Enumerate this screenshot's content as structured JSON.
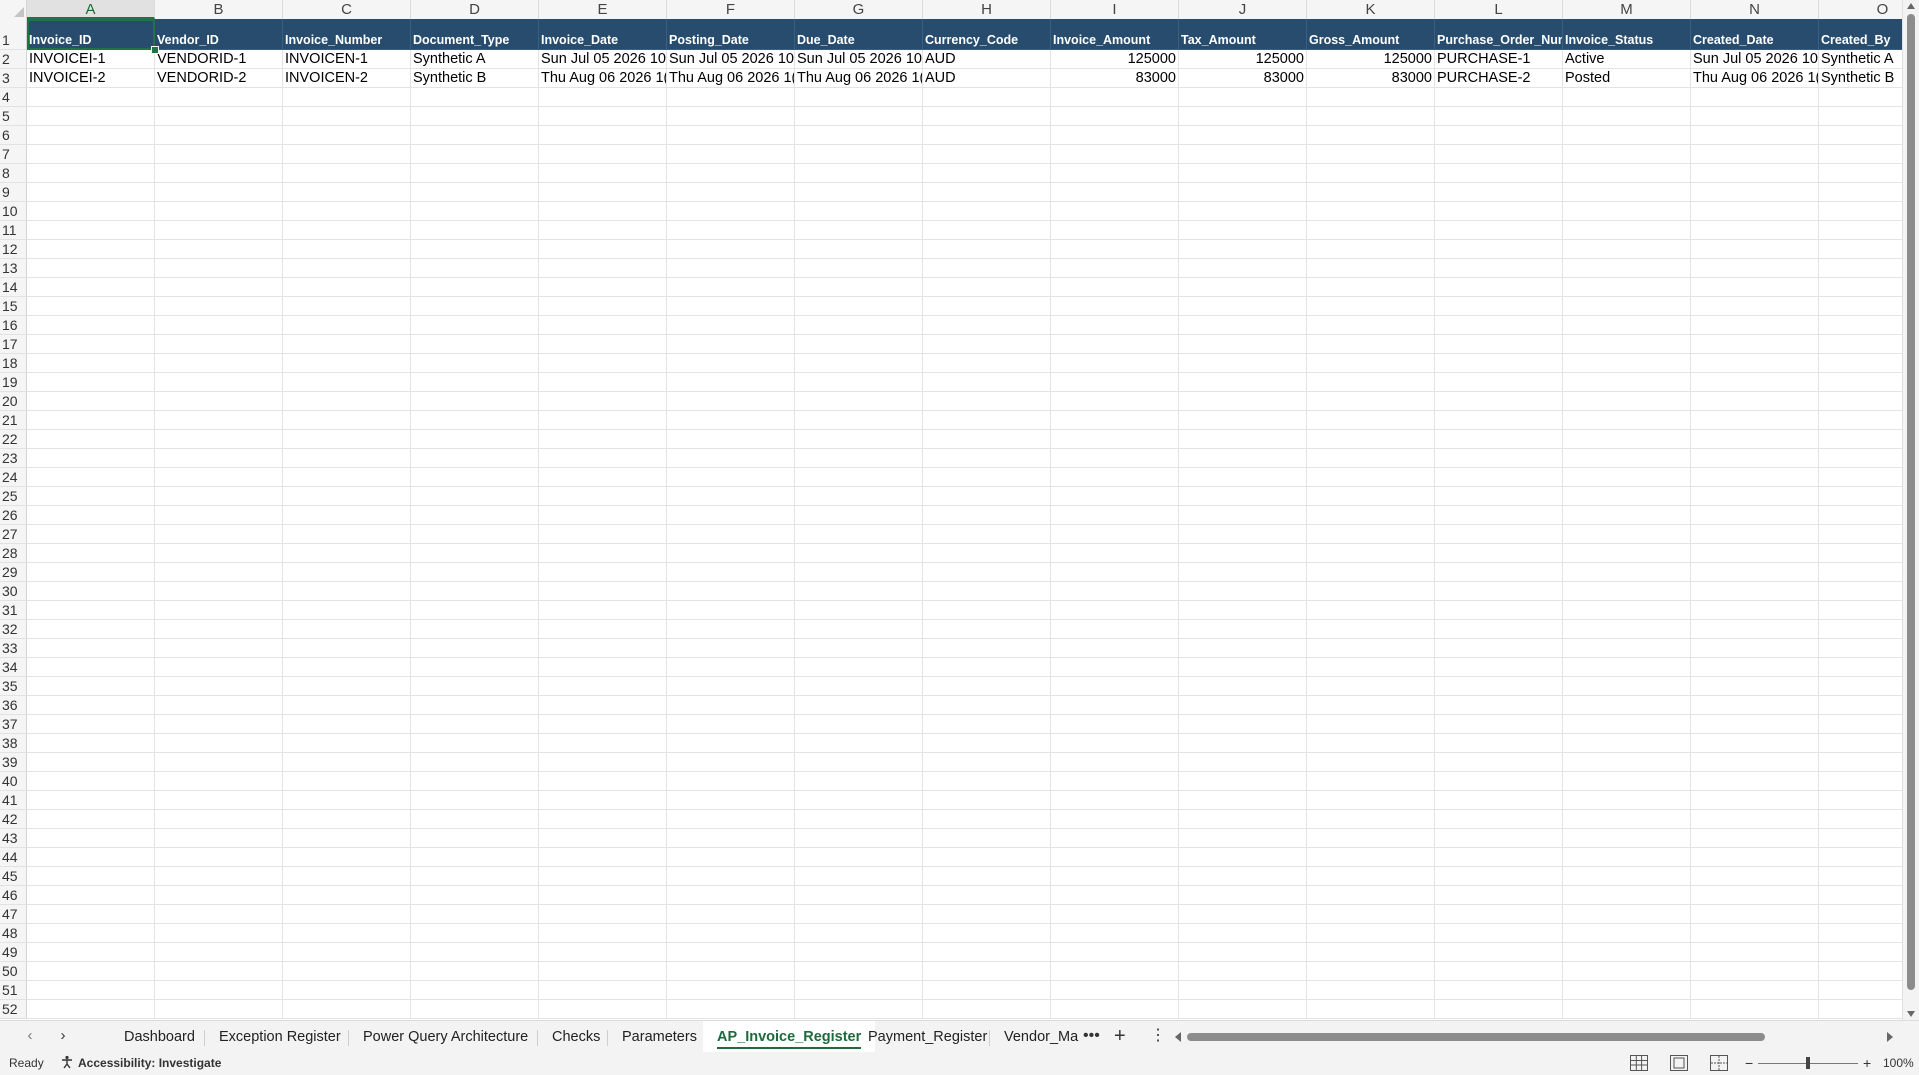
{
  "columns": [
    "A",
    "B",
    "C",
    "D",
    "E",
    "F",
    "G",
    "H",
    "I",
    "J",
    "K",
    "L",
    "M",
    "N",
    "O"
  ],
  "row_numbers": [
    "1",
    "2",
    "3",
    "4",
    "5",
    "6",
    "7",
    "8",
    "9",
    "10",
    "11",
    "12",
    "13",
    "14",
    "15",
    "16",
    "17",
    "18",
    "19",
    "20",
    "21",
    "22",
    "23",
    "24",
    "25",
    "26",
    "27",
    "28",
    "29",
    "30",
    "31",
    "32",
    "33",
    "34",
    "35",
    "36",
    "37",
    "38",
    "39",
    "40",
    "41",
    "42",
    "43",
    "44",
    "45",
    "46",
    "47",
    "48",
    "49",
    "50",
    "51",
    "52"
  ],
  "header_row": [
    "Invoice_ID",
    "Vendor_ID",
    "Invoice_Number",
    "Document_Type",
    "Invoice_Date",
    "Posting_Date",
    "Due_Date",
    "Currency_Code",
    "Invoice_Amount",
    "Tax_Amount",
    "Gross_Amount",
    "Purchase_Order_Number",
    "Invoice_Status",
    "Created_Date",
    "Created_By"
  ],
  "rows": [
    [
      "INVOICEI-1",
      "VENDORID-1",
      "INVOICEN-1",
      "Synthetic A",
      "Sun Jul 05 2026 10",
      "Sun Jul 05 2026 10",
      "Sun Jul 05 2026 10",
      "AUD",
      "125000",
      "125000",
      "125000",
      "PURCHASE-1",
      "Active",
      "Sun Jul 05 2026 10",
      "Synthetic A"
    ],
    [
      "INVOICEI-2",
      "VENDORID-2",
      "INVOICEN-2",
      "Synthetic B",
      "Thu Aug 06 2026 1(",
      "Thu Aug 06 2026 1(",
      "Thu Aug 06 2026 1(",
      "AUD",
      "83000",
      "83000",
      "83000",
      "PURCHASE-2",
      "Posted",
      "Thu Aug 06 2026 1(",
      "Synthetic B"
    ]
  ],
  "numeric_columns": [
    8,
    9,
    10
  ],
  "active_cell": "A1",
  "sheet_tabs": [
    "Dashboard",
    "Exception Register",
    "Power Query Architecture",
    "Checks",
    "Parameters",
    "AP_Invoice_Register",
    "Payment_Register",
    "Vendor_Ma"
  ],
  "active_tab": "AP_Invoice_Register",
  "tab_more_label": "•••",
  "add_sheet_label": "+",
  "tab_menu_label": "⋮",
  "status": {
    "ready": "Ready",
    "accessibility": "Accessibility: Investigate",
    "zoom": "100%",
    "zoom_minus": "−",
    "zoom_plus": "+"
  },
  "colors": {
    "header_fill": "#284c6e",
    "header_text": "#ffffff",
    "selection": "#217346"
  }
}
